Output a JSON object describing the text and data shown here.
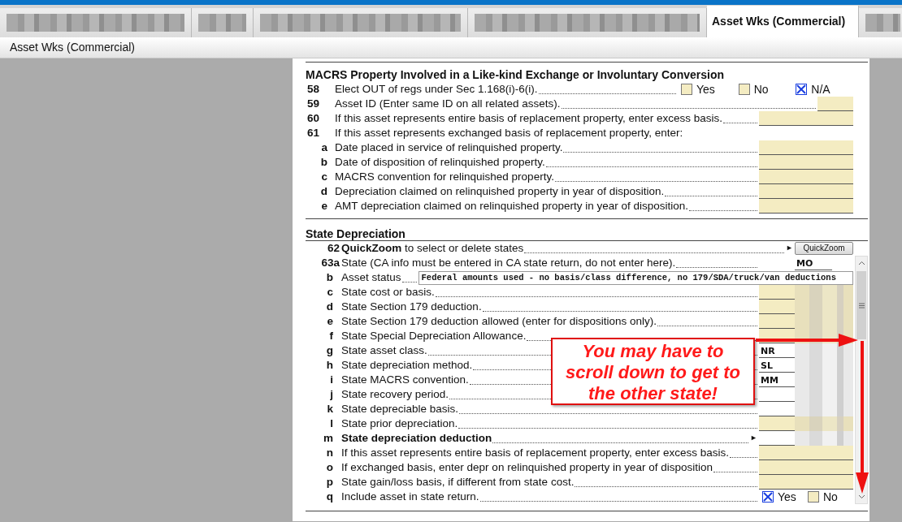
{
  "tabs": [
    {
      "kind": "redacted",
      "selected": false
    },
    {
      "kind": "redacted",
      "selected": false
    },
    {
      "kind": "redacted",
      "selected": false
    },
    {
      "kind": "redacted",
      "selected": false
    },
    {
      "kind": "label",
      "label": "Asset Wks (Commercial)",
      "selected": true
    },
    {
      "kind": "redacted",
      "selected": false
    }
  ],
  "subheader": "Asset Wks (Commercial)",
  "sections": [
    {
      "title": "MACRS Property Involved in a Like-kind Exchange or Involuntary Conversion",
      "rows": [
        {
          "num": "58",
          "label": "Elect OUT of regs under Sec 1.168(i)-6(i).",
          "kind": "choice",
          "options": [
            {
              "label": "Yes",
              "checked": false
            },
            {
              "label": "No",
              "checked": false
            },
            {
              "label": "N/A",
              "checked": true
            }
          ]
        },
        {
          "num": "59",
          "label": "Asset ID (Enter same ID on all related assets).",
          "kind": "short",
          "shaded": true
        },
        {
          "num": "60",
          "label": "If this asset represents entire basis of replacement property, enter excess basis.",
          "kind": "wide",
          "shaded": true
        },
        {
          "num": "61",
          "label": "If this asset represents exchanged basis of replacement property, enter:",
          "kind": "text",
          "children": [
            {
              "num": "a",
              "label": "Date placed in service of relinquished property.",
              "kind": "wide",
              "shaded": true
            },
            {
              "num": "b",
              "label": "Date of disposition of relinquished property.",
              "kind": "wide",
              "shaded": true
            },
            {
              "num": "c",
              "label": "MACRS convention for relinquished property.",
              "kind": "wide",
              "shaded": true
            },
            {
              "num": "d",
              "label": "Depreciation claimed on relinquished property in year of disposition.",
              "kind": "wide",
              "shaded": true
            },
            {
              "num": "e",
              "label": "AMT depreciation claimed on relinquished property in year of disposition.",
              "kind": "wide",
              "shaded": true
            }
          ]
        }
      ]
    },
    {
      "title": "State Depreciation",
      "rows": [
        {
          "num": "62",
          "label": "**QuickZoom** to select or delete states",
          "kind": "button",
          "pointer": "►",
          "button": "QuickZoom"
        },
        {
          "num": "63a",
          "label": "State (CA info must be entered in CA state return, do not enter here).",
          "kind": "code",
          "value": "MO",
          "children": [
            {
              "num": "b",
              "label": "Asset status",
              "kind": "status",
              "status": "Federal amounts used - no basis/class difference, no 179/SDA/truck/van deductions"
            },
            {
              "num": "c",
              "label": "State cost or basis.",
              "kind": "split",
              "shaded": true
            },
            {
              "num": "d",
              "label": "State Section 179 deduction.",
              "kind": "split",
              "shaded": true
            },
            {
              "num": "e",
              "label": "State Section 179 deduction allowed (enter for dispositions only).",
              "kind": "split",
              "shaded": true
            },
            {
              "num": "f",
              "label": "State Special Depreciation Allowance.",
              "kind": "split",
              "shaded": true
            },
            {
              "num": "g",
              "label": "State asset class.",
              "kind": "split",
              "shaded": false,
              "value": "NR"
            },
            {
              "num": "h",
              "label": "State depreciation method.",
              "kind": "split",
              "shaded": false,
              "value": "SL"
            },
            {
              "num": "i",
              "label": "State MACRS convention.",
              "kind": "split",
              "shaded": false,
              "value": "MM"
            },
            {
              "num": "j",
              "label": "State recovery period.",
              "kind": "split",
              "shaded": false
            },
            {
              "num": "k",
              "label": "State depreciable basis.",
              "kind": "split",
              "shaded": false
            },
            {
              "num": "l",
              "label": "State prior depreciation.",
              "kind": "split",
              "shaded": true
            },
            {
              "num": "m",
              "label": "State depreciation deduction",
              "kind": "split",
              "shaded": false,
              "bold": true,
              "pointer": "►"
            },
            {
              "num": "n",
              "label": "If this asset represents entire basis of replacement property, enter excess basis.",
              "kind": "wide",
              "shaded": true
            },
            {
              "num": "o",
              "label": "If exchanged basis, enter depr on relinquished property in year of disposition",
              "kind": "wide",
              "shaded": true
            },
            {
              "num": "p",
              "label": "State gain/loss basis, if different from state cost.",
              "kind": "wide",
              "shaded": true
            },
            {
              "num": "q",
              "label": "Include asset in state return.",
              "kind": "choice",
              "options": [
                {
                  "label": "Yes",
                  "checked": true
                },
                {
                  "label": "No",
                  "checked": false
                }
              ]
            }
          ]
        }
      ]
    }
  ],
  "callout": {
    "text": "You may have to scroll down to get to the other state!"
  }
}
